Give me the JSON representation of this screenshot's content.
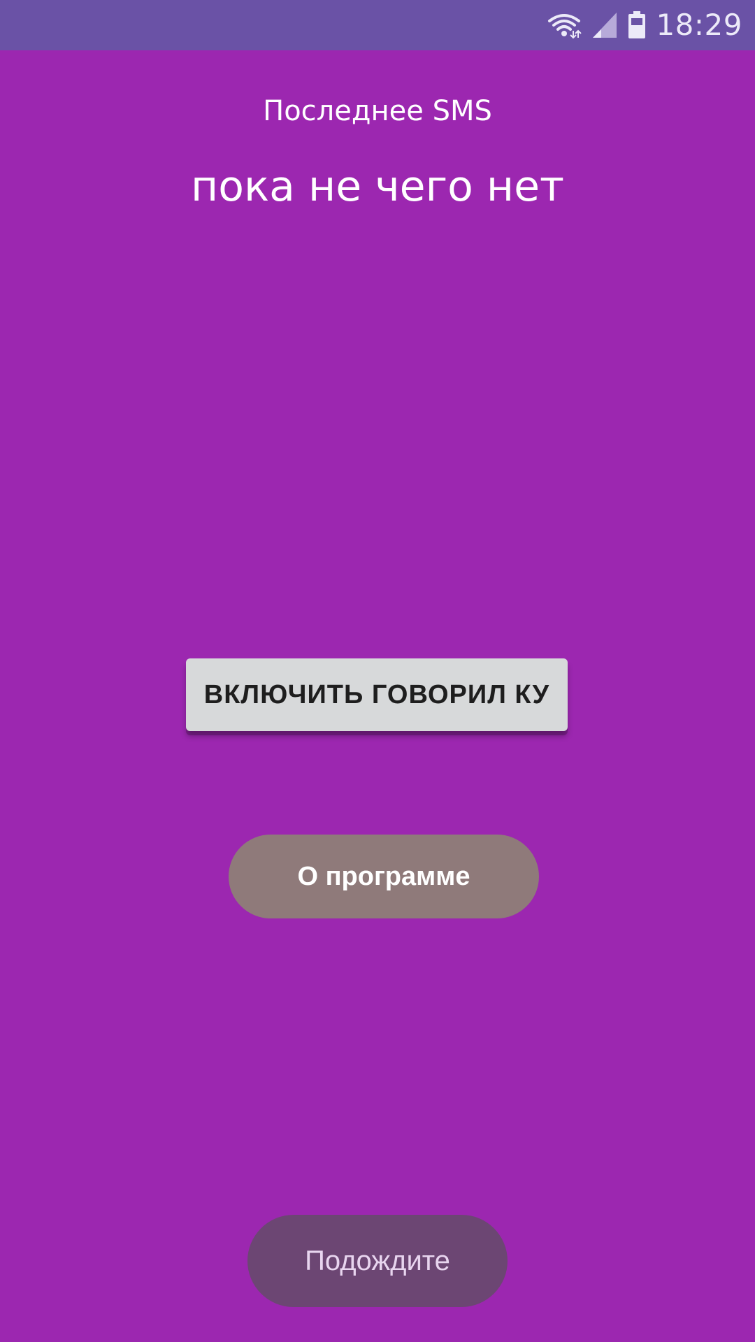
{
  "status_bar": {
    "time": "18:29",
    "icons": [
      "wifi-icon",
      "signal-icon",
      "battery-icon"
    ],
    "color": "#6A52A6"
  },
  "main": {
    "last_sms_label": "Последнее SMS",
    "last_sms_value": "пока не чего нет",
    "background_color": "#9C27B0"
  },
  "buttons": {
    "enable_label": "ВКЛЮЧИТЬ ГОВОРИЛ КУ",
    "about_label": "О программе",
    "wait_label": "Подождите"
  }
}
